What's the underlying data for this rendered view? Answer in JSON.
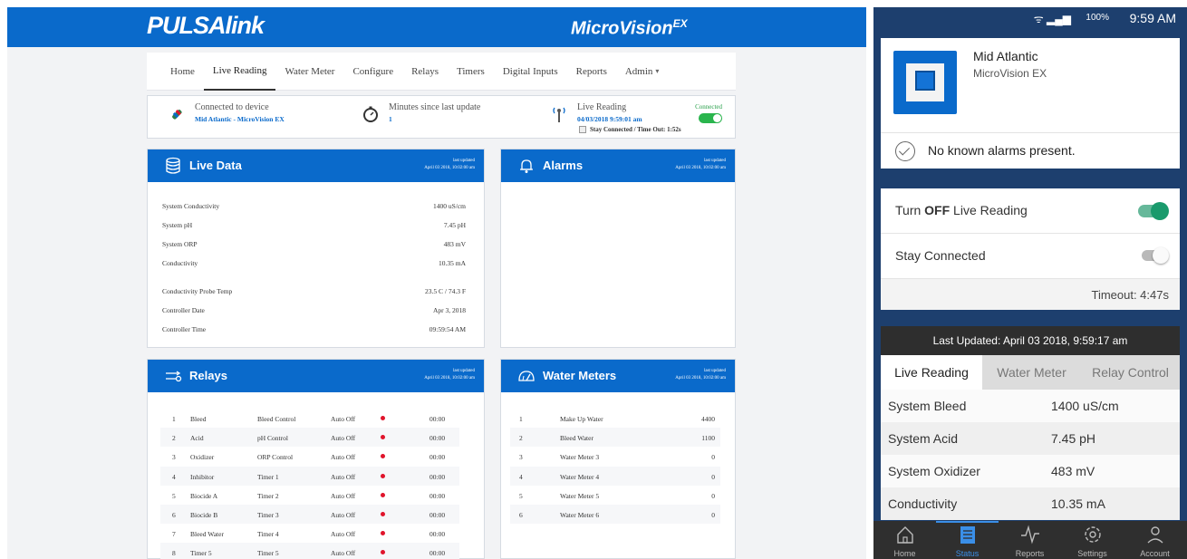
{
  "desktop": {
    "brand": "PULSAlink",
    "product": "MicroVision",
    "product_sup": "EX",
    "nav": [
      "Home",
      "Live Reading",
      "Water Meter",
      "Configure",
      "Relays",
      "Timers",
      "Digital Inputs",
      "Reports",
      "Admin"
    ],
    "nav_active": 1,
    "status": {
      "connected_label": "Connected to device",
      "connected_value": "Mid Atlantic - MicroVision EX",
      "minutes_label": "Minutes since last update",
      "minutes_value": "1",
      "live_label": "Live Reading",
      "live_value": "04/03/2018 9:59:01 am",
      "live_state": "Connected",
      "stay_label": "Stay Connected / Time Out: 1:52s"
    },
    "live_data": {
      "title": "Live Data",
      "updated_label": "last updated",
      "updated_value": "April 03 2018, 10:02:00 am",
      "rows": [
        {
          "label": "System Conductivity",
          "value": "1400 uS/cm"
        },
        {
          "label": "System pH",
          "value": "7.45 pH"
        },
        {
          "label": "System ORP",
          "value": "483 mV"
        },
        {
          "label": "Conductivity",
          "value": "10.35 mA"
        },
        {
          "label": "Conductivity Probe Temp",
          "value": "23.5 C / 74.3 F"
        },
        {
          "label": "Controller Date",
          "value": "Apr 3, 2018"
        },
        {
          "label": "Controller Time",
          "value": "09:59:54 AM"
        }
      ]
    },
    "alarms": {
      "title": "Alarms",
      "updated_label": "last updated",
      "updated_value": "April 03 2018, 10:02:00 am"
    },
    "relays": {
      "title": "Relays",
      "updated_label": "last updated",
      "updated_value": "April 03 2018, 10:02:00 am",
      "rows": [
        {
          "n": "1",
          "name": "Bleed",
          "control": "Bleed Control",
          "mode": "Auto Off",
          "time": "00:00"
        },
        {
          "n": "2",
          "name": "Acid",
          "control": "pH Control",
          "mode": "Auto Off",
          "time": "00:00"
        },
        {
          "n": "3",
          "name": "Oxidizer",
          "control": "ORP Control",
          "mode": "Auto Off",
          "time": "00:00"
        },
        {
          "n": "4",
          "name": "Inhibitor",
          "control": "Timer 1",
          "mode": "Auto Off",
          "time": "00:00"
        },
        {
          "n": "5",
          "name": "Biocide A",
          "control": "Timer 2",
          "mode": "Auto Off",
          "time": "00:00"
        },
        {
          "n": "6",
          "name": "Biocide B",
          "control": "Timer 3",
          "mode": "Auto Off",
          "time": "00:00"
        },
        {
          "n": "7",
          "name": "Bleed Water",
          "control": "Timer 4",
          "mode": "Auto Off",
          "time": "00:00"
        },
        {
          "n": "8",
          "name": "Timer 5",
          "control": "Timer 5",
          "mode": "Auto Off",
          "time": "00:00"
        }
      ]
    },
    "water_meters": {
      "title": "Water Meters",
      "updated_label": "last updated",
      "updated_value": "April 03 2018, 10:02:00 am",
      "rows": [
        {
          "n": "1",
          "name": "Make Up Water",
          "value": "4400"
        },
        {
          "n": "2",
          "name": "Bleed Water",
          "value": "1100"
        },
        {
          "n": "3",
          "name": "Water Meter 3",
          "value": "0"
        },
        {
          "n": "4",
          "name": "Water Meter 4",
          "value": "0"
        },
        {
          "n": "5",
          "name": "Water Meter 5",
          "value": "0"
        },
        {
          "n": "6",
          "name": "Water Meter 6",
          "value": "0"
        }
      ]
    }
  },
  "mobile": {
    "status_signal": "ᯤ ▂▄▆",
    "status_battery": "100%",
    "status_time": "9:59 AM",
    "device_name": "Mid Atlantic",
    "device_model": "MicroVision EX",
    "alarm_text": "No known alarms present.",
    "toggle_live_prefix": "Turn ",
    "toggle_live_bold": "OFF",
    "toggle_live_suffix": " Live Reading",
    "toggle_stay": "Stay Connected",
    "timeout": "Timeout: 4:47s",
    "last_updated": "Last Updated: April 03 2018, 9:59:17 am",
    "tabs": [
      "Live Reading",
      "Water Meter",
      "Relay Control"
    ],
    "tab_active": 0,
    "rows": [
      {
        "label": "System Bleed",
        "value": "1400 uS/cm"
      },
      {
        "label": "System Acid",
        "value": "7.45 pH"
      },
      {
        "label": "System Oxidizer",
        "value": "483 mV"
      },
      {
        "label": "Conductivity",
        "value": "10.35 mA"
      }
    ],
    "bottom_nav": [
      "Home",
      "Status",
      "Reports",
      "Settings",
      "Account"
    ],
    "bottom_active": 1
  },
  "colors": {
    "brand_blue": "#0a6acb",
    "status_red": "#e0142b",
    "connected_green": "#2ab54d",
    "toggle_teal": "#1a9a6c"
  },
  "icons": {
    "live_data": "database-icon",
    "alarms": "bell-icon",
    "relays": "relay-switch-icon",
    "water_meters": "gauge-icon",
    "connected": "plug-icon",
    "minutes": "stopwatch-icon",
    "live": "antenna-icon"
  }
}
